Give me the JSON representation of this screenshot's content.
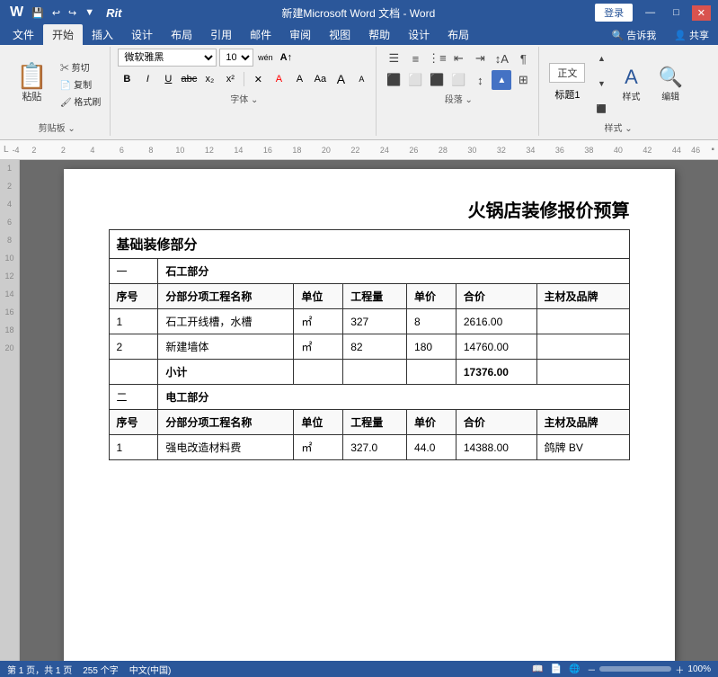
{
  "titleBar": {
    "title": "新建Microsoft Word 文档 - Word",
    "quickAccess": [
      "↩",
      "↪",
      "💾",
      "⬆"
    ],
    "rit": "Rit",
    "loginBtn": "登录",
    "windowBtns": [
      "—",
      "□",
      "✕"
    ]
  },
  "ribbonTabs": {
    "tabs": [
      "文件",
      "开始",
      "插入",
      "设计",
      "布局",
      "引用",
      "邮件",
      "审阅",
      "视图",
      "帮助",
      "设计",
      "布局"
    ],
    "activeTab": "开始",
    "rightTabs": [
      "告诉我",
      "共享"
    ]
  },
  "ribbon": {
    "groups": {
      "clipboard": {
        "label": "剪贴板",
        "pasteBtn": "粘贴",
        "cutBtn": "剪切",
        "copyBtn": "复制",
        "formatBtn": "格式刷"
      },
      "font": {
        "label": "字体",
        "fontName": "微软雅黑",
        "fontSize": "10",
        "bold": "B",
        "italic": "I",
        "underline": "U",
        "strikethrough": "abc",
        "subscript": "x₂",
        "superscript": "x²",
        "clearFormat": "✕",
        "fontColor": "A",
        "highlight": "A",
        "fontColorBtn": "Aa"
      },
      "paragraph": {
        "label": "段落"
      },
      "styles": {
        "label": "样式",
        "editLabel": "编辑"
      },
      "editing": {
        "label": ""
      }
    }
  },
  "document": {
    "mainTitle": "火锅店装修报价预算",
    "sectionTitle": "基础装修部分",
    "sections": [
      {
        "number": "一",
        "name": "石工部分",
        "headers": [
          "序号",
          "分部分项工程名称",
          "单位",
          "工程量",
          "单价",
          "合价",
          "主材及品牌"
        ],
        "rows": [
          {
            "no": "1",
            "name": "石工开线槽，水槽",
            "unit": "㎡",
            "qty": "327",
            "price": "8",
            "total": "2616.00",
            "brand": ""
          },
          {
            "no": "2",
            "name": "新建墙体",
            "unit": "㎡",
            "qty": "82",
            "price": "180",
            "total": "14760.00",
            "brand": ""
          }
        ],
        "subtotal": {
          "label": "小计",
          "total": "17376.00"
        }
      },
      {
        "number": "二",
        "name": "电工部分",
        "headers": [
          "序号",
          "分部分项工程名称",
          "单位",
          "工程量",
          "单价",
          "合价",
          "主材及品牌"
        ],
        "rows": [
          {
            "no": "1",
            "name": "强电改造材料费",
            "unit": "㎡",
            "qty": "327.0",
            "price": "44.0",
            "total": "14388.00",
            "brand": "鸽牌 BV"
          }
        ]
      }
    ]
  },
  "statusBar": {
    "pageInfo": "第 1 页，共 1 页",
    "wordCount": "255 个字",
    "lang": "中文(中国)",
    "zoom": "100%",
    "zoomValue": 100
  }
}
